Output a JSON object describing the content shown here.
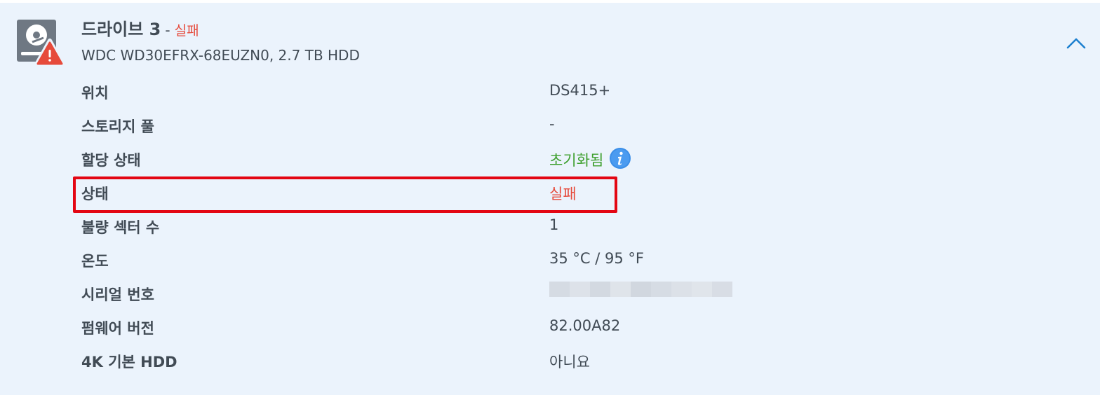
{
  "drive": {
    "name": "드라이브 3",
    "separator": "-",
    "status": "실패",
    "model": "WDC WD30EFRX-68EUZN0, 2.7 TB HDD",
    "icon": "hdd-warning-icon"
  },
  "collapse": {
    "icon": "chevron-up-icon"
  },
  "details": {
    "location": {
      "label": "위치",
      "value": "DS415+"
    },
    "storage_pool": {
      "label": "스토리지 풀",
      "value": "-"
    },
    "allocation": {
      "label": "할당 상태",
      "value": "초기화됨",
      "icon": "info-icon"
    },
    "status": {
      "label": "상태",
      "value": "실패"
    },
    "bad_sectors": {
      "label": "불량 섹터 수",
      "value": "1"
    },
    "temperature": {
      "label": "온도",
      "value": "35 °C / 95 °F"
    },
    "serial": {
      "label": "시리얼 번호"
    },
    "firmware": {
      "label": "펌웨어 버전",
      "value": "82.00A82"
    },
    "native_4k": {
      "label": "4K 기본 HDD",
      "value": "아니요"
    }
  },
  "colors": {
    "panel_bg": "#ebf3fc",
    "text": "#414b55",
    "failed": "#e64a3b",
    "initialized": "#3d9f2d",
    "highlight": "#e30613",
    "accent": "#1b7fcf"
  }
}
